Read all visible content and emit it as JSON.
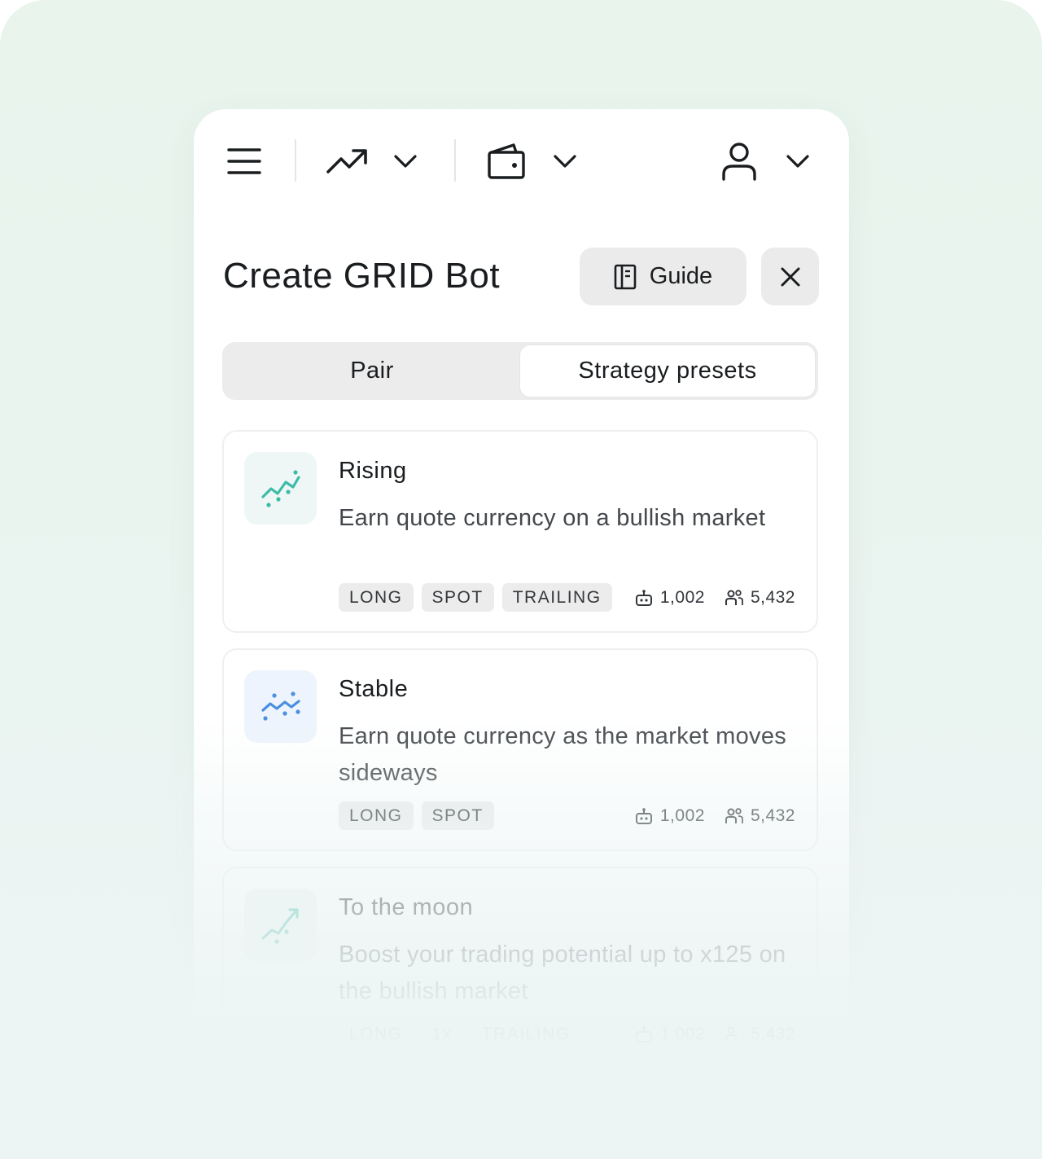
{
  "nav": {
    "menu_icon": "hamburger-menu-icon",
    "trade_icon": "trend-up-icon",
    "wallet_icon": "wallet-icon",
    "account_icon": "user-icon",
    "chevron_icon": "chevron-down-icon"
  },
  "header": {
    "title": "Create GRID Bot",
    "guide_label": "Guide",
    "guide_icon": "book-icon",
    "close_icon": "close-icon"
  },
  "tabs": [
    {
      "label": "Pair",
      "active": false
    },
    {
      "label": "Strategy presets",
      "active": true
    }
  ],
  "presets": [
    {
      "title": "Rising",
      "description": "Earn quote currency on a bullish market",
      "icon": "rising-chart-icon",
      "tags": [
        "LONG",
        "SPOT",
        "TRAILING"
      ],
      "bots": "1,002",
      "users": "5,432"
    },
    {
      "title": "Stable",
      "description": "Earn quote currency as the market moves sideways",
      "icon": "sideways-chart-icon",
      "tags": [
        "LONG",
        "SPOT"
      ],
      "bots": "1,002",
      "users": "5,432"
    },
    {
      "title": "To the moon",
      "description": "Boost your trading potential up to x125 on the bullish market",
      "icon": "moon-chart-icon",
      "tags": [
        "LONG",
        "1x",
        "TRAILING"
      ],
      "bots": "1,002",
      "users": "5,432"
    }
  ],
  "colors": {
    "teal_accent": "#3dbba8",
    "blue_accent": "#4b8fe0",
    "surface_gray": "#ebebeb",
    "text_primary": "#1a1d1f"
  }
}
